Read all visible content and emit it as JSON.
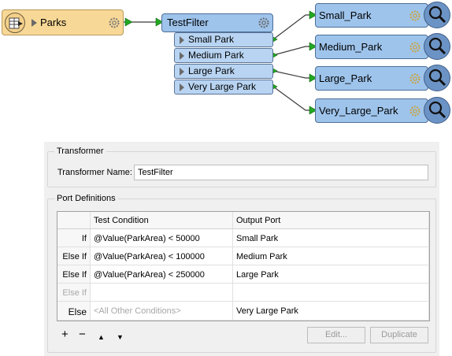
{
  "canvas": {
    "reader": {
      "label": "Parks",
      "icon": "table-icon"
    },
    "filter": {
      "label": "TestFilter"
    },
    "ports": [
      {
        "label": "Small Park"
      },
      {
        "label": "Medium Park"
      },
      {
        "label": "Large Park"
      },
      {
        "label": "Very Large Park"
      }
    ],
    "inspectors": [
      {
        "label": "Small_Park"
      },
      {
        "label": "Medium_Park"
      },
      {
        "label": "Large_Park"
      },
      {
        "label": "Very_Large_Park"
      }
    ],
    "colors": {
      "reader_fill": "#f8d896",
      "transformer_fill": "#9ec4ec",
      "port_fill": "#b8d4f2",
      "connection": "#3a3a3a",
      "port_arrow": "#22a822"
    }
  },
  "panel": {
    "transformer_group": {
      "legend": "Transformer",
      "name_label": "Transformer Name:",
      "name_value": "TestFilter"
    },
    "ports_group": {
      "legend": "Port Definitions",
      "columns": {
        "condition": "Test Condition",
        "output": "Output Port"
      },
      "rows": [
        {
          "type": "If",
          "condition": "@Value(ParkArea) < 50000",
          "output": "Small Park"
        },
        {
          "type": "Else If",
          "condition": "@Value(ParkArea) < 100000",
          "output": "Medium Park"
        },
        {
          "type": "Else If",
          "condition": "@Value(ParkArea) < 250000",
          "output": "Large Park"
        },
        {
          "type": "Else If",
          "condition": "",
          "output": ""
        },
        {
          "type": "Else",
          "condition": "<All Other Conditions>",
          "output": "Very Large Park"
        }
      ],
      "toolbar": {
        "add": "+",
        "remove": "−",
        "up": "▲",
        "down": "▼"
      },
      "edit_button": "Edit...",
      "duplicate_button": "Duplicate"
    }
  }
}
